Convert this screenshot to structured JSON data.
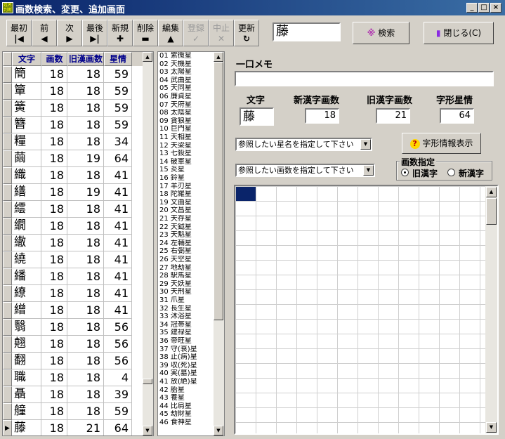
{
  "window": {
    "title": "画数検索、変更、追加画面",
    "app_icon_text": "姓名判断"
  },
  "toolbar": {
    "first": "最初",
    "prev": "前",
    "next": "次",
    "last": "最後",
    "new": "新規",
    "delete": "削除",
    "edit": "編集",
    "register": "登録",
    "cancel": "中止",
    "refresh": "更新",
    "search_value": "藤",
    "search_button": "検索",
    "close_button": "閉じる(C)"
  },
  "grid": {
    "headers": [
      "文字",
      "画数",
      "旧漢画数",
      "星情"
    ],
    "rows": [
      [
        "簡",
        "18",
        "18",
        "59"
      ],
      [
        "簞",
        "18",
        "18",
        "59"
      ],
      [
        "簧",
        "18",
        "18",
        "59"
      ],
      [
        "簪",
        "18",
        "18",
        "59"
      ],
      [
        "糧",
        "18",
        "18",
        "34"
      ],
      [
        "繭",
        "18",
        "19",
        "64"
      ],
      [
        "織",
        "18",
        "18",
        "41"
      ],
      [
        "繕",
        "18",
        "19",
        "41"
      ],
      [
        "繧",
        "18",
        "18",
        "41"
      ],
      [
        "繝",
        "18",
        "18",
        "41"
      ],
      [
        "繖",
        "18",
        "18",
        "41"
      ],
      [
        "繞",
        "18",
        "18",
        "41"
      ],
      [
        "繙",
        "18",
        "18",
        "41"
      ],
      [
        "繚",
        "18",
        "18",
        "41"
      ],
      [
        "繒",
        "18",
        "18",
        "41"
      ],
      [
        "翳",
        "18",
        "18",
        "56"
      ],
      [
        "翹",
        "18",
        "18",
        "56"
      ],
      [
        "翻",
        "18",
        "18",
        "56"
      ],
      [
        "職",
        "18",
        "18",
        "4"
      ],
      [
        "聶",
        "18",
        "18",
        "39"
      ],
      [
        "艟",
        "18",
        "18",
        "59"
      ],
      [
        "藤",
        "18",
        "21",
        "64"
      ]
    ],
    "current_row": 21
  },
  "stars": [
    "01 紫微星",
    "02 天機星",
    "03 太陽星",
    "04 武曲星",
    "05 天同星",
    "06 廉貞星",
    "07 天府星",
    "08 太陰星",
    "09 貪狼星",
    "10 巨門星",
    "11 天相星",
    "12 天梁星",
    "13 七殺星",
    "14 破軍星",
    "15 炎星",
    "16 鈴星",
    "17 羊刃星",
    "18 陀羅星",
    "19 文曲星",
    "20 文昌星",
    "21 天存星",
    "22 天鉞星",
    "23 天魁星",
    "24 左輔星",
    "25 右弼星",
    "26 天空星",
    "27 地劫星",
    "28 駅馬星",
    "29 天妖星",
    "30 天刑星",
    "31 爪星",
    "32 長生星",
    "33 沐浴星",
    "34 冠帯星",
    "35 建禄星",
    "36 帝旺星",
    "37 守(衰)星",
    "38 止(病)星",
    "39 収(死)星",
    "40 実(墓)星",
    "41 放(絶)星",
    "42 胎星",
    "43 養星",
    "44 比肩星",
    "45 劫財星",
    "46 食神星"
  ],
  "memo": {
    "label": "一口メモ",
    "value": ""
  },
  "info": {
    "char_label": "文字",
    "char_value": "藤",
    "new_label": "新漢字画数",
    "new_value": "18",
    "old_label": "旧漢字画数",
    "old_value": "21",
    "star_label": "字形星情",
    "star_value": "64"
  },
  "combos": {
    "star_placeholder": "参照したい星名を指定して下さい",
    "stroke_placeholder": "参照したい画数を指定して下さい"
  },
  "info_button": "字形情報表示",
  "stroke_mode": {
    "label": "画数指定",
    "old_label": "旧漢字",
    "new_label": "新漢字",
    "selected": "旧漢字"
  },
  "colors": {
    "title_start": "#0a246a",
    "title_end": "#3a6ea5",
    "header_text": "#00008b",
    "selection": "#0a246a"
  }
}
